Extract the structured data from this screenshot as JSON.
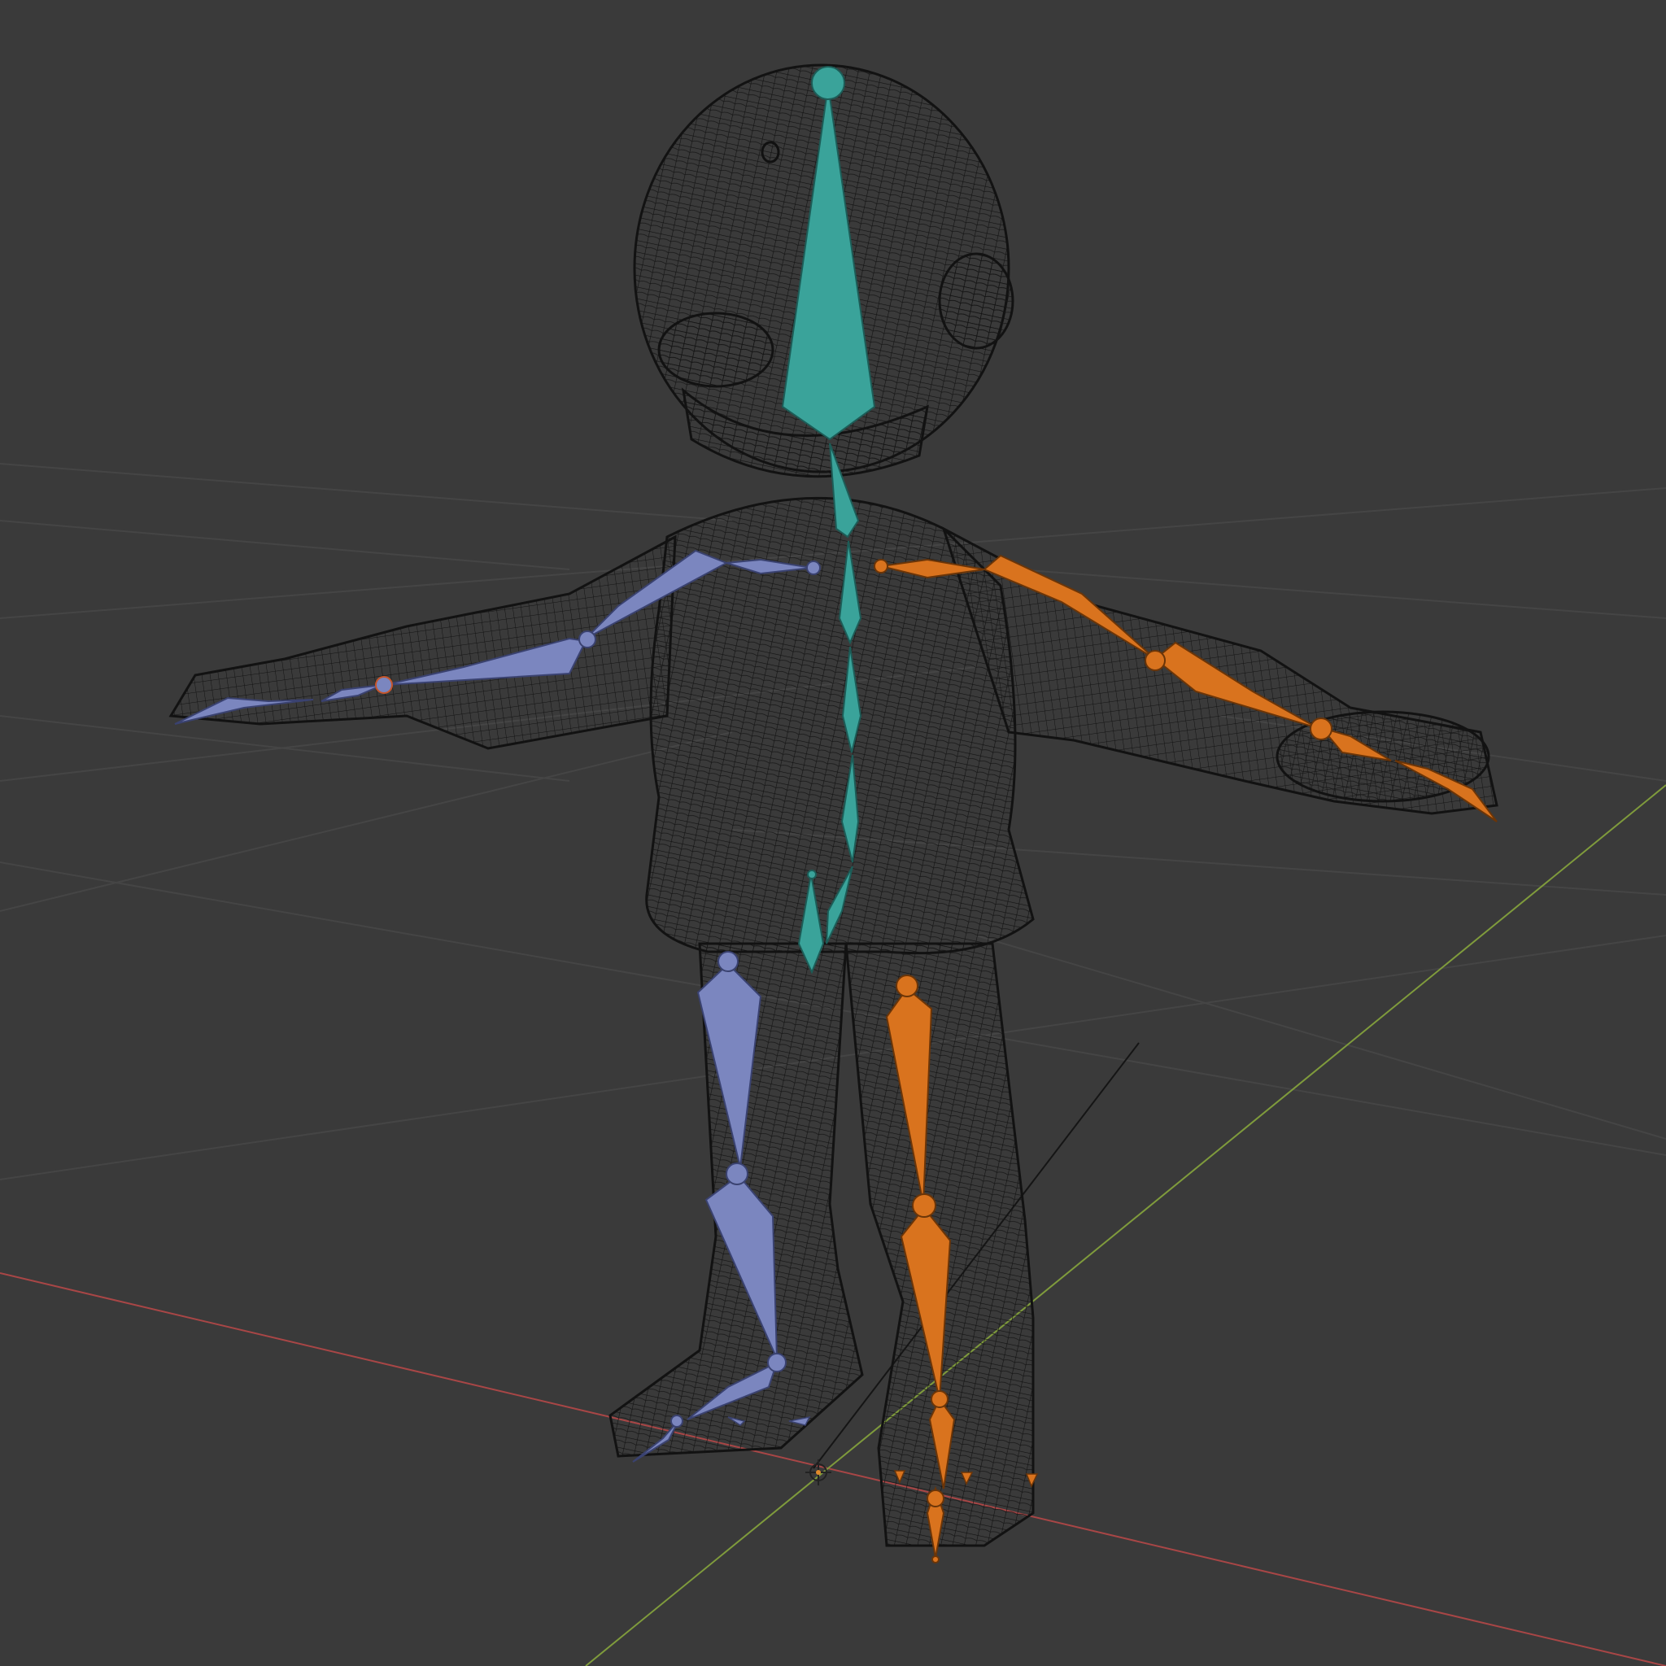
{
  "viewport": {
    "background_color": "#3a3a3a",
    "grid_color": "#4a4a4a",
    "x_axis_color": "#b04444",
    "y_axis_color": "#7a9a3a",
    "wireframe_color": "#111111",
    "mesh_fill_color": "#2f2f2f"
  },
  "armature": {
    "center_chain_color": "#3aa39a",
    "left_chain_color": "#7b86bf",
    "right_chain_color": "#d9731e",
    "center_bones": [
      "head",
      "neck",
      "spine-upper",
      "spine-mid",
      "spine-lower",
      "spine-base",
      "hips"
    ],
    "left_bones": [
      "shoulder-l",
      "upper-arm-l",
      "forearm-l",
      "hand-l",
      "thigh-l",
      "shin-l",
      "foot-l"
    ],
    "right_bones": [
      "shoulder-r",
      "upper-arm-r",
      "forearm-r",
      "hand-r",
      "thigh-r",
      "shin-r",
      "foot-r"
    ]
  },
  "icons": {
    "origin": "3d-cursor-icon"
  }
}
